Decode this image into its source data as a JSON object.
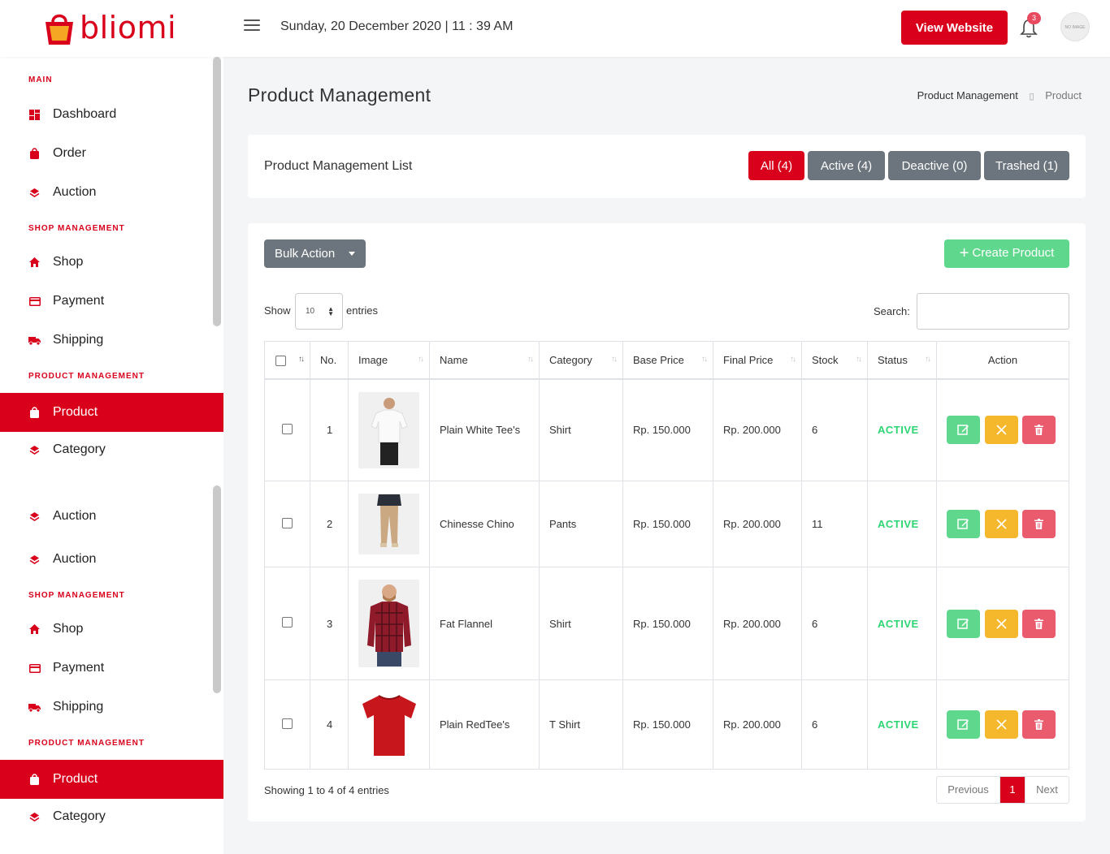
{
  "brand": {
    "name": "bliomi",
    "accent": "#d9001b"
  },
  "header": {
    "datetime": "Sunday, 20 December 2020 | 11 : 39 AM",
    "view_website": "View Website",
    "notification_count": "3",
    "avatar_text": "NO IMAGE"
  },
  "sidebar": {
    "sections": [
      {
        "heading": "MAIN",
        "items": [
          {
            "label": "Dashboard",
            "icon": "dashboard-icon"
          },
          {
            "label": "Order",
            "icon": "shopping-bag-icon"
          },
          {
            "label": "Auction",
            "icon": "layers-icon"
          }
        ]
      },
      {
        "heading": "SHOP MANAGEMENT",
        "items": [
          {
            "label": "Shop",
            "icon": "home-icon"
          },
          {
            "label": "Payment",
            "icon": "credit-card-icon"
          },
          {
            "label": "Shipping",
            "icon": "truck-icon"
          }
        ]
      },
      {
        "heading": "PRODUCT MANAGEMENT",
        "items": [
          {
            "label": "Product",
            "icon": "shopping-bag-icon",
            "active": true
          },
          {
            "label": "Category",
            "icon": "layers-icon"
          }
        ]
      },
      {
        "heading": "",
        "items": [
          {
            "label": "Auction",
            "icon": "layers-icon"
          },
          {
            "label": "Auction",
            "icon": "layers-icon"
          }
        ]
      },
      {
        "heading": "SHOP MANAGEMENT",
        "items": [
          {
            "label": "Shop",
            "icon": "home-icon"
          },
          {
            "label": "Payment",
            "icon": "credit-card-icon"
          },
          {
            "label": "Shipping",
            "icon": "truck-icon"
          }
        ]
      },
      {
        "heading": "PRODUCT MANAGEMENT",
        "items": [
          {
            "label": "Product",
            "icon": "shopping-bag-icon",
            "active": true
          },
          {
            "label": "Category",
            "icon": "layers-icon"
          }
        ]
      }
    ]
  },
  "page": {
    "title": "Product Management",
    "breadcrumb": [
      "Product Management",
      "Product"
    ]
  },
  "list_card": {
    "title": "Product Management List",
    "filters": [
      "All (4)",
      "Active (4)",
      "Deactive (0)",
      "Trashed (1)"
    ]
  },
  "table_card": {
    "bulk_action": "Bulk Action",
    "create": "Create Product",
    "show_label": "Show",
    "entries_value": "10",
    "entries_label": "entries",
    "search_label": "Search:",
    "columns": [
      "No.",
      "Image",
      "Name",
      "Category",
      "Base Price",
      "Final Price",
      "Stock",
      "Status",
      "Action"
    ],
    "rows": [
      {
        "no": "1",
        "image": "white-tshirt-model",
        "name": "Plain White Tee's",
        "category": "Shirt",
        "base": "Rp. 150.000",
        "final": "Rp. 200.000",
        "stock": "6",
        "status": "ACTIVE"
      },
      {
        "no": "2",
        "image": "chino-pants-model",
        "name": "Chinesse Chino",
        "category": "Pants",
        "base": "Rp. 150.000",
        "final": "Rp. 200.000",
        "stock": "11",
        "status": "ACTIVE"
      },
      {
        "no": "3",
        "image": "flannel-shirt-model",
        "name": "Fat Flannel",
        "category": "Shirt",
        "base": "Rp. 150.000",
        "final": "Rp. 200.000",
        "stock": "6",
        "status": "ACTIVE"
      },
      {
        "no": "4",
        "image": "red-tshirt",
        "name": "Plain RedTee's",
        "category": "T Shirt",
        "base": "Rp. 150.000",
        "final": "Rp. 200.000",
        "stock": "6",
        "status": "ACTIVE"
      }
    ],
    "showing": "Showing 1 to 4 of 4 entries",
    "pagination": {
      "previous": "Previous",
      "current": "1",
      "next": "Next"
    }
  }
}
